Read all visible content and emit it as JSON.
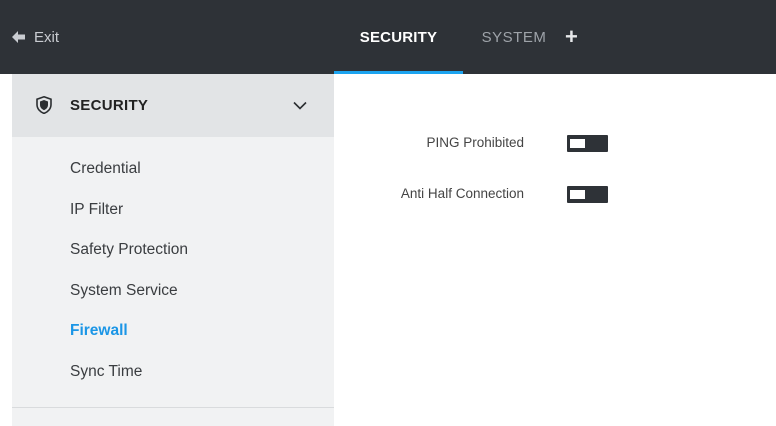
{
  "topbar": {
    "exit_label": "Exit",
    "tabs": [
      {
        "label": "SECURITY",
        "active": true
      },
      {
        "label": "SYSTEM",
        "active": false
      }
    ],
    "add_tab_label": "+"
  },
  "sidebar": {
    "section_title": "SECURITY",
    "section_icon": "shield-icon",
    "collapse_icon": "chevron-down-icon",
    "items": [
      {
        "label": "Credential",
        "active": false
      },
      {
        "label": "IP Filter",
        "active": false
      },
      {
        "label": "Safety Protection",
        "active": false
      },
      {
        "label": "System Service",
        "active": false
      },
      {
        "label": "Firewall",
        "active": true
      },
      {
        "label": "Sync Time",
        "active": false
      }
    ]
  },
  "main": {
    "settings": [
      {
        "label": "PING Prohibited",
        "enabled": false
      },
      {
        "label": "Anti Half Connection",
        "enabled": false
      }
    ]
  },
  "colors": {
    "topbar_bg": "#2e3237",
    "accent": "#1ca4f0",
    "active_menu": "#1b96e6",
    "sidebar_bg": "#f1f2f3",
    "sidebar_header_bg": "#e2e4e6"
  }
}
